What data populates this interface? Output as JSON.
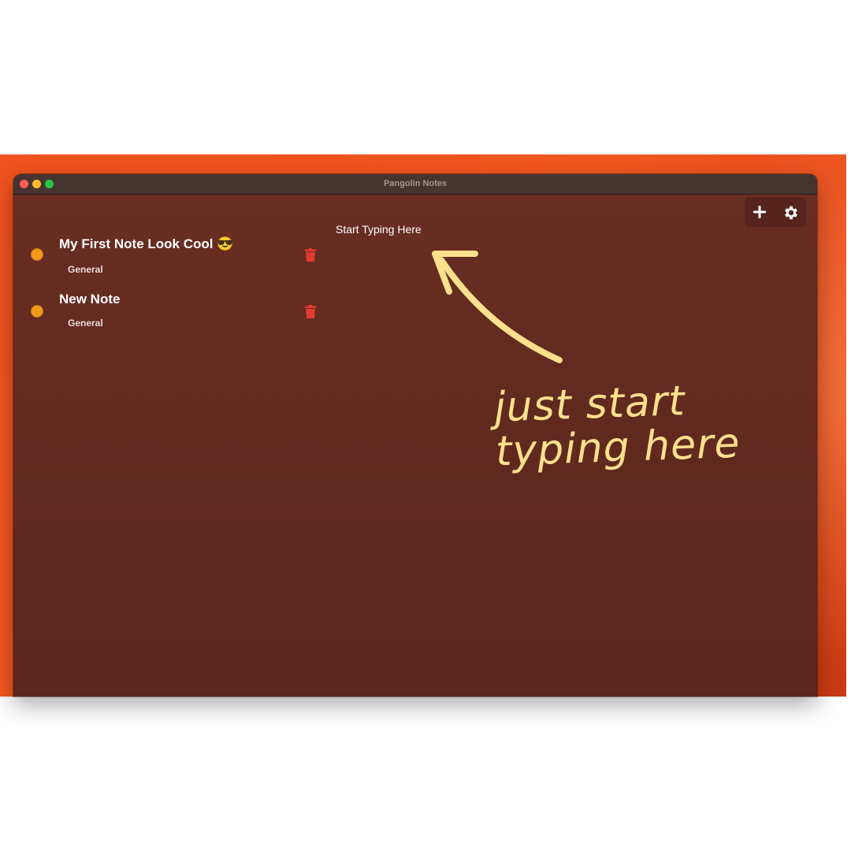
{
  "window": {
    "title": "Pangolin Notes"
  },
  "toolbar": {
    "add_icon": "plus-icon",
    "settings_icon": "gear-icon"
  },
  "notes": [
    {
      "title": "My First Note Look Cool 😎",
      "category": "General",
      "color": "#f29a1a"
    },
    {
      "title": "New Note",
      "category": "General",
      "color": "#f29a1a"
    }
  ],
  "editor": {
    "placeholder": "Start Typing Here"
  },
  "annotation": {
    "line1": "just start",
    "line2": "typing here",
    "color": "#fde08c"
  },
  "colors": {
    "accent_delete": "#e53a2f",
    "window_bg": "#632a1f",
    "wallpaper": "#f2521f"
  }
}
